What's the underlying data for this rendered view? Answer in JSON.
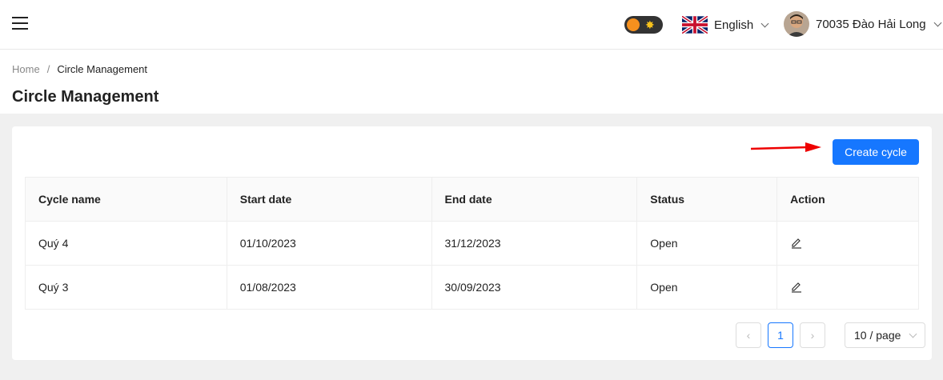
{
  "topbar": {
    "language_label": "English",
    "user_name": "70035 Đào Hải Long"
  },
  "breadcrumb": {
    "home": "Home",
    "separator": "/",
    "current": "Circle Management"
  },
  "page_title": "Circle Management",
  "toolbar": {
    "create_label": "Create cycle"
  },
  "table": {
    "headers": [
      "Cycle name",
      "Start date",
      "End date",
      "Status",
      "Action"
    ],
    "rows": [
      {
        "name": "Quý 4",
        "start": "01/10/2023",
        "end": "31/12/2023",
        "status": "Open"
      },
      {
        "name": "Quý 3",
        "start": "01/08/2023",
        "end": "30/09/2023",
        "status": "Open"
      }
    ]
  },
  "pagination": {
    "prev_icon": "‹",
    "current_page": "1",
    "next_icon": "›",
    "page_size": "10 / page"
  },
  "colors": {
    "primary": "#1677ff",
    "status_open": "#22dd22",
    "toggle_knob": "#f5901e"
  }
}
